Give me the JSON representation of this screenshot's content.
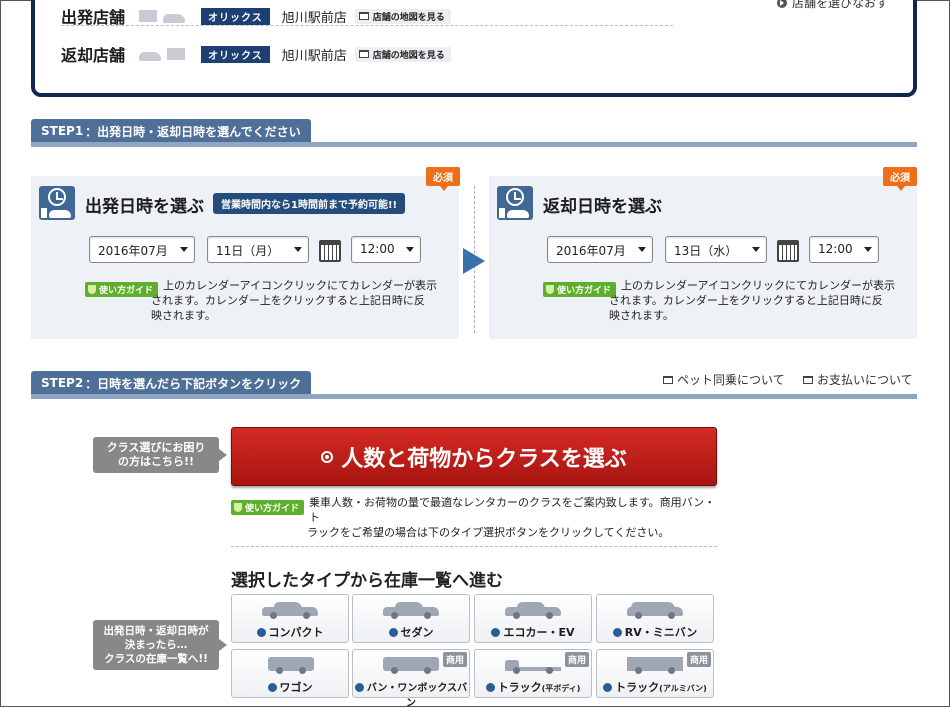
{
  "store": {
    "departure_label": "出発店舗",
    "return_label": "返却店舗",
    "brand": "オリックス",
    "departure_store": "旭川駅前店",
    "return_store": "旭川駅前店",
    "map_link": "店舗の地図を見る",
    "reselect_link": "店舗を選びなおす"
  },
  "step1": {
    "num": "STEP1",
    "label": "：出発日時・返却日時を選んでください",
    "required": "必須",
    "departure": {
      "title": "出発日時を選ぶ",
      "note": "営業時間内なら1時間前まで予約可能!!",
      "month": "2016年07月",
      "day": "11日（月）",
      "time": "12:00"
    },
    "return": {
      "title": "返却日時を選ぶ",
      "month": "2016年07月",
      "day": "13日（水）",
      "time": "12:00"
    },
    "guide_badge": "使い方ガイド",
    "guide_line1": "上のカレンダーアイコンクリックにてカレンダーが表示",
    "guide_line2": "されます。カレンダー上をクリックすると上記日時に反",
    "guide_line3": "映されます。"
  },
  "step2": {
    "num": "STEP2",
    "label": "：日時を選んだら下記ボタンをクリック",
    "pet_link": "ペット同乗について",
    "payment_link": "お支払いについて",
    "help_label_line1": "クラス選びにお困り",
    "help_label_line2": "の方はこちら!!",
    "class_button": "人数と荷物からクラスを選ぶ",
    "guide_badge": "使い方ガイド",
    "guide_line1": "乗車人数・お荷物の量で最適なレンタカーのクラスをご案内致します。商用バン・ト",
    "guide_line2": "ラックをご希望の場合は下のタイプ選択ボタンをクリックしてください。",
    "types_heading": "選択したタイプから在庫一覧へ進む",
    "side_label_line1": "出発日時・返却日時が",
    "side_label_line2": "決まったら…",
    "side_label_line3": "クラスの在庫一覧へ!!",
    "commercial_tag": "商用",
    "types": [
      {
        "label": "コンパクト",
        "sub": ""
      },
      {
        "label": "セダン",
        "sub": ""
      },
      {
        "label": "エコカー・EV",
        "sub": ""
      },
      {
        "label": "RV・ミニバン",
        "sub": ""
      },
      {
        "label": "ワゴン",
        "sub": ""
      },
      {
        "label": "バン・ワンボックスバン",
        "sub": ""
      },
      {
        "label": "トラック",
        "sub": "(平ボディ)"
      },
      {
        "label": "トラック",
        "sub": "(アルミバン)"
      }
    ]
  },
  "colors": {
    "navy": "#0f2850",
    "step_tab": "#4e6f97",
    "required": "#ee6e1a",
    "guide_green": "#5fae2e",
    "primary_button": "#c0201b"
  }
}
